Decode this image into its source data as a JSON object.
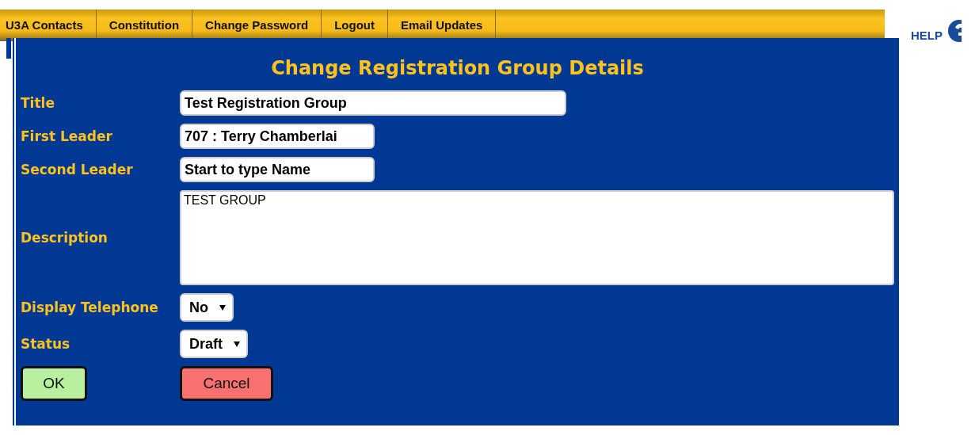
{
  "menu": [
    {
      "label": "U3A Contacts"
    },
    {
      "label": "Constitution"
    },
    {
      "label": "Change Password"
    },
    {
      "label": "Logout"
    },
    {
      "label": "Email Updates"
    }
  ],
  "help": {
    "label": "HELP"
  },
  "form": {
    "title": "Change Registration Group Details",
    "fields": [
      {
        "kind": "wide_text",
        "label": "Title",
        "value": "Test Registration Group"
      },
      {
        "kind": "text",
        "label": "First Leader",
        "value": "707 : Terry Chamberlai"
      },
      {
        "kind": "text",
        "label": "Second Leader",
        "value": "Start to type Name"
      },
      {
        "kind": "textarea",
        "label": "Description",
        "value": "TEST GROUP"
      },
      {
        "kind": "select",
        "label": "Display Telephone",
        "value": "No"
      },
      {
        "kind": "select",
        "label": "Status",
        "value": "Draft"
      }
    ],
    "buttons": [
      {
        "label": "OK",
        "kind": "ok"
      },
      {
        "label": "Cancel",
        "kind": "cancel"
      }
    ]
  }
}
